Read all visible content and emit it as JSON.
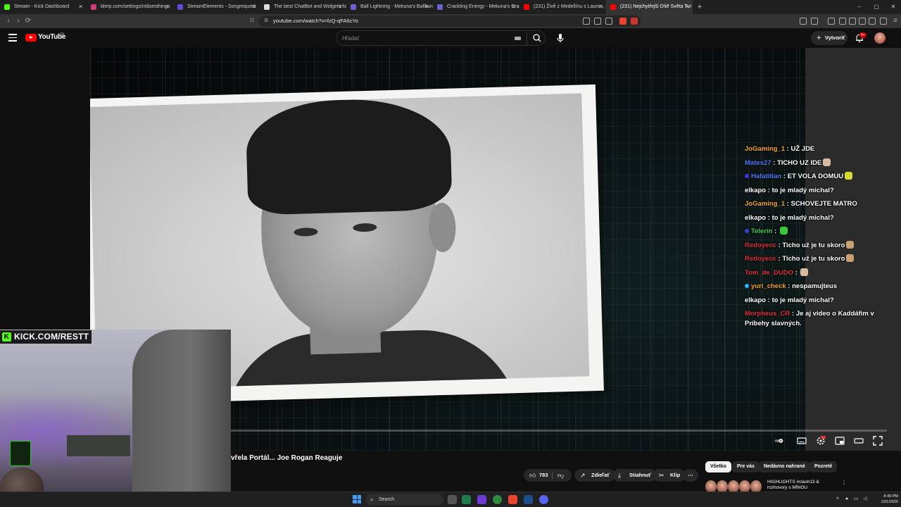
{
  "browser": {
    "tabs": [
      {
        "title": "Stream - Kick Dashboard",
        "color": "#53fc18"
      },
      {
        "title": "blerp.com/settings/ntdoesthings",
        "color": "#d23b7a"
      },
      {
        "title": "StreamElements - Songrequest",
        "color": "#5f4bd8"
      },
      {
        "title": "The best ChatBot and Widgets for K",
        "color": "#dddddd"
      },
      {
        "title": "Ball Lightning - Mekuna's Ballkuna",
        "color": "#6a63c9"
      },
      {
        "title": "Crackling Energy - Mekuna's Crackun",
        "color": "#6a63c9"
      },
      {
        "title": "(231) Živě z Medellínu s Laurou, Koi",
        "color": "#ff0000"
      },
      {
        "title": "(231) Nejchytřejší Dítě Světa Tvr",
        "color": "#ff0000"
      }
    ],
    "active_tab_index": 7,
    "new_tab_label": "+",
    "url": "youtube.com/watch?v=fzQ-qFA6cYo",
    "window_controls": [
      "–",
      "▢",
      "✕"
    ]
  },
  "youtube": {
    "wordmark": "YouTube",
    "country": "SK",
    "search_placeholder": "Hľadať",
    "create_label": "Vytvoriť",
    "notif_count": "9+"
  },
  "overlay": {
    "kick_url": "KICK.COM/RESTT",
    "kick_logo_letter": "K"
  },
  "chat": [
    {
      "user": "JoGaming_1",
      "user_color": "#f5a623",
      "text": "UŽ JDE",
      "emote": null
    },
    {
      "user": "Mates27",
      "user_color": "#4a7bff",
      "text": "TICHO UZ IDE",
      "emote": "#d9b9a0"
    },
    {
      "user": "Hafatitlan",
      "user_color": "#4a7bff",
      "text": "ET VOLA DOMUU",
      "emote": "#d8d830",
      "badge": "#3a3ad8"
    },
    {
      "user": "elkapo",
      "user_color": "#ffffff",
      "text": "to je mladý michal?",
      "emote": null
    },
    {
      "user": "JoGaming_1",
      "user_color": "#f5a623",
      "text": "SCHOVEJTE MATRO",
      "emote": null
    },
    {
      "user": "elkapo",
      "user_color": "#ffffff",
      "text": "to je mladý michal?",
      "emote": null
    },
    {
      "user": "Telerin",
      "user_color": "#39d353",
      "text": "",
      "emote": "#39c939",
      "badge": "#3a3ad8"
    },
    {
      "user": "Redoyecc",
      "user_color": "#e0333a",
      "text": "Ticho už je tu skoro",
      "emote": "#c8a070"
    },
    {
      "user": "Redoyecc",
      "user_color": "#e0333a",
      "text": "Ticho už je tu skoro",
      "emote": "#c8a070"
    },
    {
      "user": "Tom_de_DUDO",
      "user_color": "#e0333a",
      "text": "",
      "emote": "#d9b9a0"
    },
    {
      "user": "yuri_check",
      "user_color": "#f5a623",
      "text": "nespamujteus",
      "emote": null,
      "badge": "#2ab0ff"
    },
    {
      "user": "elkapo",
      "user_color": "#ffffff",
      "text": "to je mladý michal?",
      "emote": null
    },
    {
      "user": "Morpheus_CR",
      "user_color": "#e0333a",
      "text": "Je aj video o Kaddáfim v Príbehy slavných.",
      "emote": null
    }
  ],
  "video": {
    "title_visible": "vřela Portál... Joe Rogan Reaguje",
    "like_count": "783",
    "share_label": "Zdieľať",
    "download_label": "Stiahnuť",
    "clip_label": "Klip",
    "more_label": "⋯"
  },
  "recommendations": {
    "chips": [
      "Všetko",
      "Pre vás",
      "Nedávno nahrané",
      "Pozreté"
    ],
    "active_chip": 0,
    "first_title": "HIGHLIGHTS #clash13 & rozhovory s MÍNOU"
  },
  "taskbar": {
    "search_label": "Search",
    "time": "8:49 PM",
    "date": "10/1/2025"
  }
}
